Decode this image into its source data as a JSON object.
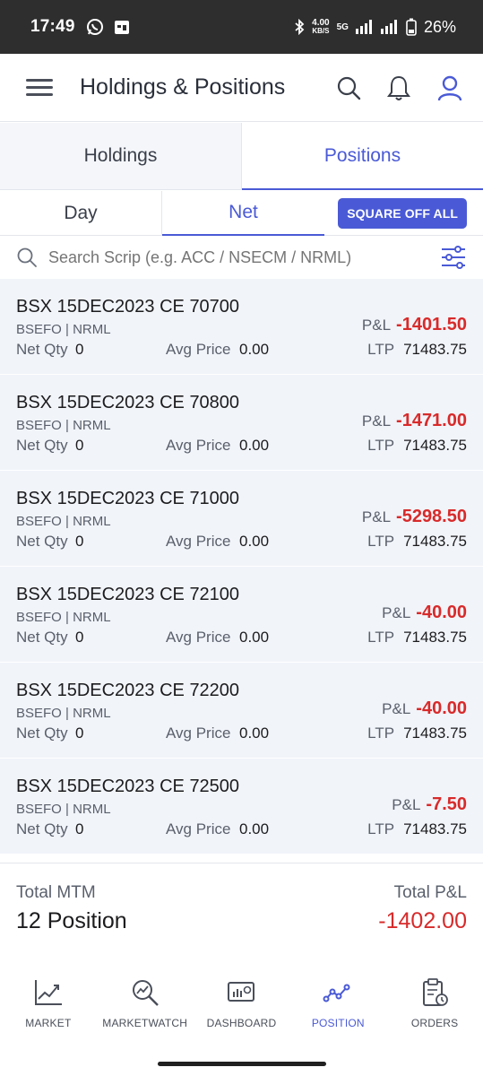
{
  "status_bar": {
    "time": "17:49",
    "net_speed_value": "4.00",
    "net_speed_unit": "KB/S",
    "network": "5G",
    "battery": "26%"
  },
  "header": {
    "title": "Holdings & Positions"
  },
  "tabs": {
    "holdings": "Holdings",
    "positions": "Positions"
  },
  "subtabs": {
    "day": "Day",
    "net": "Net",
    "square_off": "SQUARE OFF ALL"
  },
  "search": {
    "placeholder": "Search Scrip (e.g. ACC / NSECM / NRML)"
  },
  "labels": {
    "net_qty": "Net Qty",
    "avg_price": "Avg Price",
    "pnl": "P&L",
    "ltp": "LTP"
  },
  "positions": [
    {
      "name": "BSX 15DEC2023 CE 70700",
      "exchange": "BSEFO | NRML",
      "net_qty": "0",
      "avg_price": "0.00",
      "pnl": "-1401.50",
      "ltp": "71483.75"
    },
    {
      "name": "BSX 15DEC2023 CE 70800",
      "exchange": "BSEFO | NRML",
      "net_qty": "0",
      "avg_price": "0.00",
      "pnl": "-1471.00",
      "ltp": "71483.75"
    },
    {
      "name": "BSX 15DEC2023 CE 71000",
      "exchange": "BSEFO | NRML",
      "net_qty": "0",
      "avg_price": "0.00",
      "pnl": "-5298.50",
      "ltp": "71483.75"
    },
    {
      "name": "BSX 15DEC2023 CE 72100",
      "exchange": "BSEFO | NRML",
      "net_qty": "0",
      "avg_price": "0.00",
      "pnl": "-40.00",
      "ltp": "71483.75"
    },
    {
      "name": "BSX 15DEC2023 CE 72200",
      "exchange": "BSEFO | NRML",
      "net_qty": "0",
      "avg_price": "0.00",
      "pnl": "-40.00",
      "ltp": "71483.75"
    },
    {
      "name": "BSX 15DEC2023 CE 72500",
      "exchange": "BSEFO | NRML",
      "net_qty": "0",
      "avg_price": "0.00",
      "pnl": "-7.50",
      "ltp": "71483.75"
    }
  ],
  "summary": {
    "total_mtm_label": "Total MTM",
    "total_mtm_value": "12 Position",
    "total_pnl_label": "Total P&L",
    "total_pnl_value": "-1402.00"
  },
  "bottom_nav": {
    "market": "MARKET",
    "marketwatch": "MARKETWATCH",
    "dashboard": "DASHBOARD",
    "position": "POSITION",
    "orders": "ORDERS"
  },
  "colors": {
    "accent": "#4a5ad6",
    "loss": "#d82a2a",
    "row_bg": "#f1f4f9"
  }
}
